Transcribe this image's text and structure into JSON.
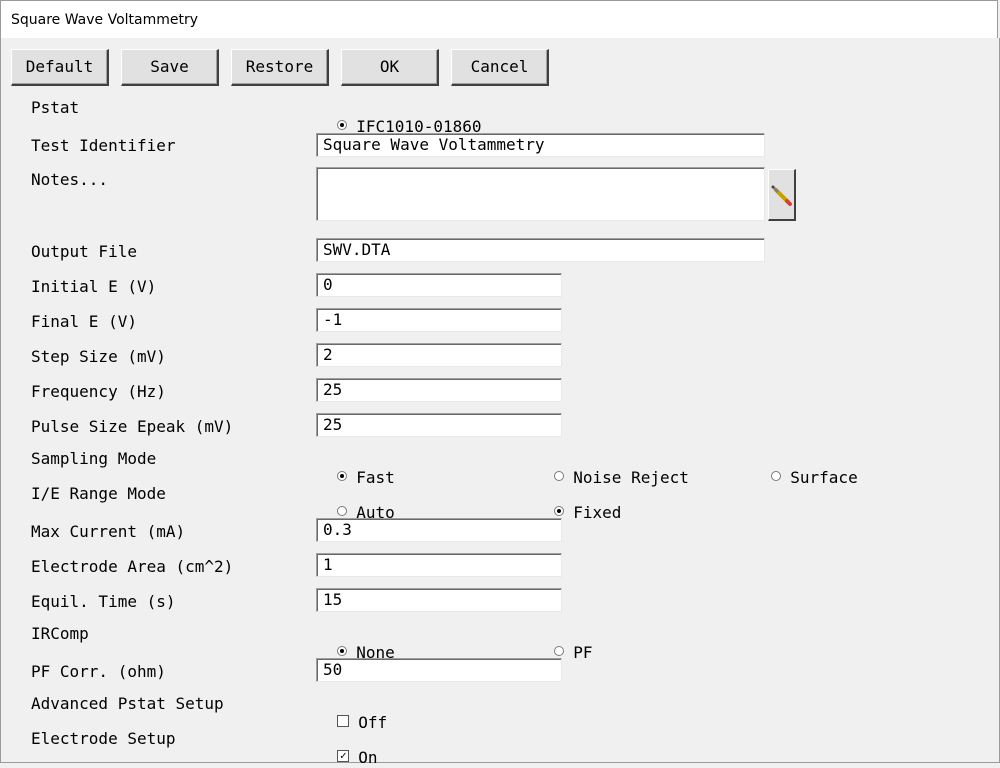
{
  "window": {
    "title": "Square Wave Voltammetry"
  },
  "buttons": {
    "default": "Default",
    "save": "Save",
    "restore": "Restore",
    "ok": "OK",
    "cancel": "Cancel"
  },
  "pstat": {
    "label": "Pstat",
    "option": "IFC1010-01860"
  },
  "test_identifier": {
    "label": "Test Identifier",
    "value": "Square Wave Voltammetry"
  },
  "notes": {
    "label": "Notes...",
    "value": "",
    "edit_icon": "pencil-icon"
  },
  "output_file": {
    "label": "Output File",
    "value": "SWV.DTA"
  },
  "initial_e": {
    "label": "Initial E (V)",
    "value": "0"
  },
  "final_e": {
    "label": "Final E (V)",
    "value": "-1"
  },
  "step_size": {
    "label": "Step Size (mV)",
    "value": "2"
  },
  "frequency": {
    "label": "Frequency (Hz)",
    "value": "25"
  },
  "pulse_size": {
    "label": "Pulse Size Epeak (mV)",
    "value": "25"
  },
  "sampling_mode": {
    "label": "Sampling Mode",
    "options": [
      "Fast",
      "Noise Reject",
      "Surface"
    ],
    "selected": "Fast"
  },
  "ie_range_mode": {
    "label": "I/E Range Mode",
    "options": [
      "Auto",
      "Fixed"
    ],
    "selected": "Fixed"
  },
  "max_current": {
    "label": "Max Current (mA)",
    "value": "0.3"
  },
  "electrode_area": {
    "label": "Electrode Area (cm^2)",
    "value": "1"
  },
  "equil_time": {
    "label": "Equil. Time (s)",
    "value": "15"
  },
  "ircomp": {
    "label": "IRComp",
    "options": [
      "None",
      "PF"
    ],
    "selected": "None"
  },
  "pf_corr": {
    "label": "PF Corr. (ohm)",
    "value": "50"
  },
  "advanced_pstat": {
    "label": "Advanced Pstat Setup",
    "state": "Off",
    "checked": false
  },
  "electrode_setup": {
    "label": "Electrode Setup",
    "state": "On",
    "checked": true
  }
}
